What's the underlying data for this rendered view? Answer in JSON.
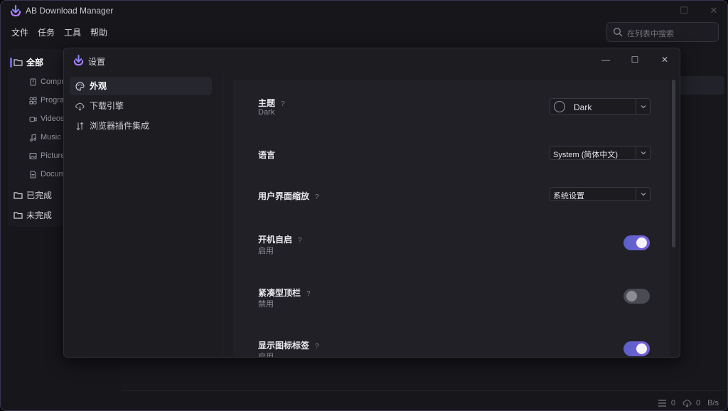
{
  "app": {
    "title": "AB Download Manager"
  },
  "menu": [
    "文件",
    "任务",
    "工具",
    "帮助"
  ],
  "search": {
    "placeholder": "在列表中搜索"
  },
  "categories": [
    {
      "label": "全部",
      "icon": "folder-icon",
      "active": true
    },
    {
      "label": "已完成",
      "icon": "folder-icon"
    },
    {
      "label": "未完成",
      "icon": "folder-icon"
    }
  ],
  "subcategories": [
    {
      "label": "Compr",
      "icon": "archive-icon"
    },
    {
      "label": "Progra",
      "icon": "apps-icon"
    },
    {
      "label": "Videos",
      "icon": "video-icon"
    },
    {
      "label": "Music",
      "icon": "music-icon"
    },
    {
      "label": "Picture",
      "icon": "image-icon"
    },
    {
      "label": "Docum",
      "icon": "document-icon"
    }
  ],
  "status": {
    "queue_count": "0",
    "speed_value": "0",
    "speed_unit": "B/s"
  },
  "dialog": {
    "title": "设置",
    "nav": [
      {
        "label": "外观",
        "icon": "palette-icon",
        "active": true
      },
      {
        "label": "下载引擎",
        "icon": "cloud-download-icon"
      },
      {
        "label": "浏览器插件集成",
        "icon": "swap-icon"
      }
    ],
    "help_mark": "?",
    "settings": {
      "theme": {
        "label": "主题",
        "sub": "Dark",
        "value": "Dark"
      },
      "language": {
        "label": "语言",
        "value": "System (简体中文)"
      },
      "ui_scale": {
        "label": "用户界面缩放",
        "value": "系统设置"
      },
      "autostart": {
        "label": "开机自启",
        "sub": "启用",
        "enabled": true
      },
      "compact_topbar": {
        "label": "紧凑型顶栏",
        "sub": "禁用",
        "enabled": false
      },
      "icon_labels": {
        "label": "显示图标标签",
        "sub": "启用",
        "enabled": true
      }
    }
  },
  "colors": {
    "accent": "#6b66d6",
    "toggle_on": "#6a60d0",
    "background": "#16161b",
    "dialog_bg": "#1c1c21"
  }
}
